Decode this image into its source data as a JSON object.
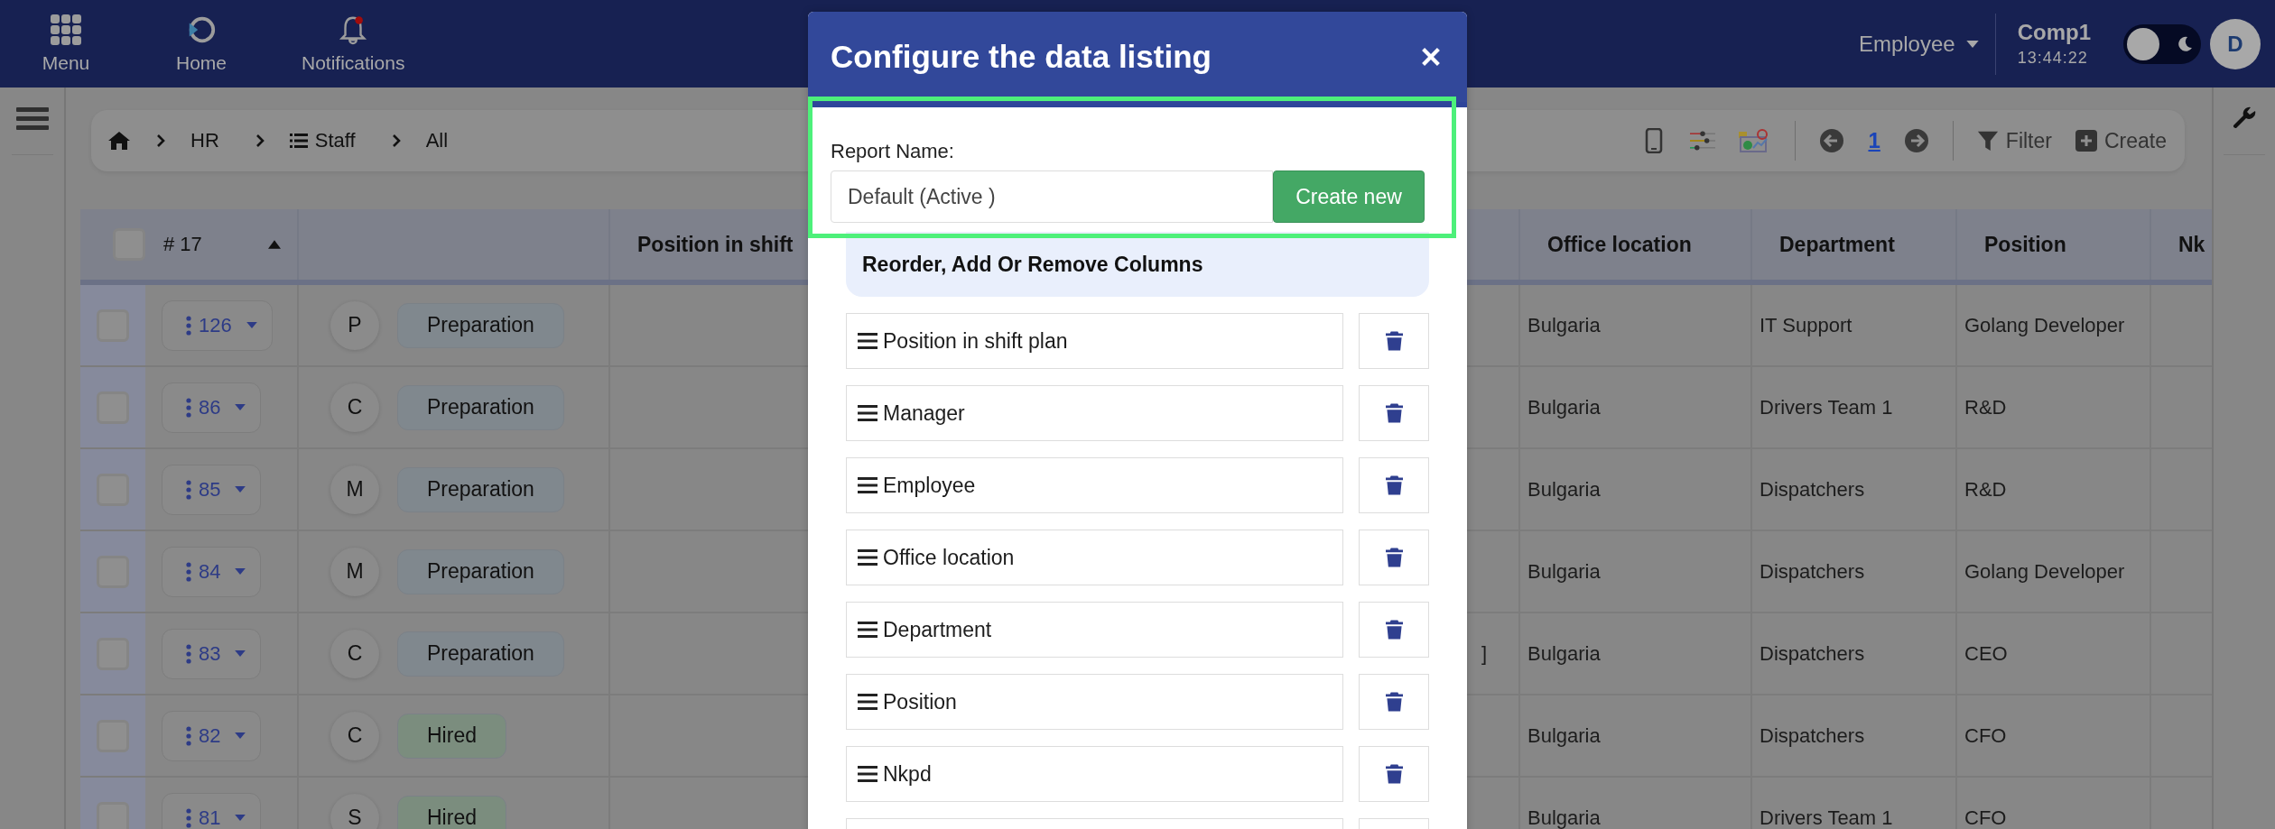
{
  "top_nav": [
    {
      "kind": "menu",
      "label": "Menu"
    },
    {
      "kind": "home",
      "label": "Home"
    },
    {
      "kind": "notifications",
      "label": "Notifications",
      "unread": true
    }
  ],
  "role_menu": {
    "label": "Employee"
  },
  "company": {
    "name": "Comp1",
    "time": "13:44:22"
  },
  "theme_toggle": {
    "on": false
  },
  "avatar": {
    "initial": "D"
  },
  "breadcrumb": [
    {
      "kind": "home"
    },
    {
      "kind": "text",
      "label": "HR"
    },
    {
      "kind": "list",
      "label": "Staff"
    },
    {
      "kind": "text",
      "label": "All"
    }
  ],
  "toolbar": {
    "page": "1",
    "filter": "Filter",
    "create": "Create"
  },
  "table": {
    "select_all": {
      "checked": false
    },
    "count_label": "# 17",
    "columns": [
      "Position in shift",
      "Office location",
      "Department",
      "Position",
      "Nk"
    ],
    "rows": [
      {
        "checked": false,
        "id": "126",
        "initial": "P",
        "status": "Preparation",
        "color": "#80888e",
        "column_4": null,
        "office": "Bulgaria",
        "department": "IT Support",
        "position": "Golang Developer"
      },
      {
        "checked": false,
        "id": "86",
        "initial": "C",
        "status": "Preparation",
        "color": "#80888e",
        "column_4": null,
        "office": "Bulgaria",
        "department": "Drivers Team 1",
        "position": "R&D"
      },
      {
        "checked": false,
        "id": "85",
        "initial": "M",
        "status": "Preparation",
        "color": "#80888e",
        "column_4": null,
        "office": "Bulgaria",
        "department": "Dispatchers",
        "position": "R&D"
      },
      {
        "checked": false,
        "id": "84",
        "initial": "M",
        "status": "Preparation",
        "color": "#80888e",
        "column_4": null,
        "office": "Bulgaria",
        "department": "Dispatchers",
        "position": "Golang Developer"
      },
      {
        "checked": false,
        "id": "83",
        "initial": "C",
        "status": "Preparation",
        "color": "#80888e",
        "column_4": "]",
        "office": "Bulgaria",
        "department": "Dispatchers",
        "position": "CEO"
      },
      {
        "checked": false,
        "id": "82",
        "initial": "C",
        "status": "Hired",
        "color": "#7b8d7e",
        "column_4": null,
        "office": "Bulgaria",
        "department": "Dispatchers",
        "position": "CFO"
      },
      {
        "checked": false,
        "id": "81",
        "initial": "S",
        "status": "Hired",
        "color": "#7b8d7e",
        "column_4": null,
        "office": "Bulgaria",
        "department": "Drivers Team 1",
        "position": "CFO"
      }
    ]
  },
  "dialog": {
    "title": "Configure the data listing",
    "report_label": "Report Name:",
    "report_value": "Default (Active )",
    "create_button": "Create new",
    "section_title": "Reorder, Add Or Remove Columns",
    "columns": [
      "Position in shift plan",
      "Manager",
      "Employee",
      "Office location",
      "Department",
      "Position",
      "Nkpd"
    ]
  }
}
